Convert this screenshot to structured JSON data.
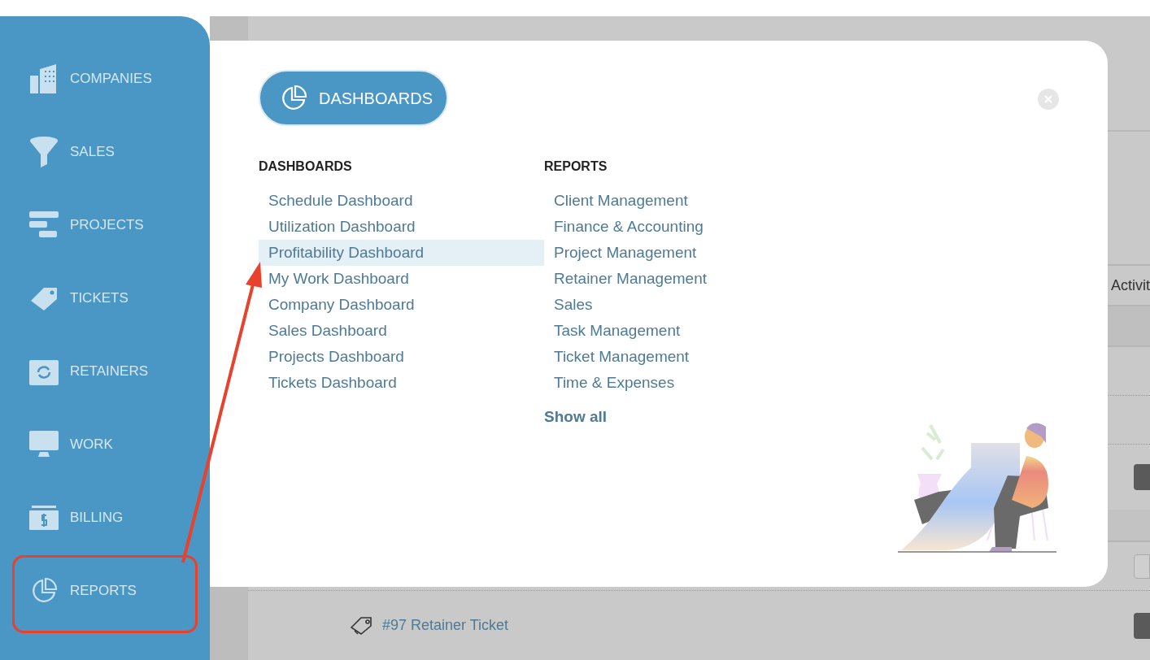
{
  "sidebar": {
    "items": [
      {
        "label": "COMPANIES"
      },
      {
        "label": "SALES"
      },
      {
        "label": "PROJECTS"
      },
      {
        "label": "TICKETS"
      },
      {
        "label": "RETAINERS"
      },
      {
        "label": "WORK"
      },
      {
        "label": "BILLING"
      },
      {
        "label": "REPORTS"
      }
    ]
  },
  "background": {
    "column_header": "Activit",
    "row_link": "#97 Retainer Ticket"
  },
  "modal": {
    "button": "DASHBOARDS",
    "columns": [
      {
        "heading": "DASHBOARDS",
        "links": [
          {
            "label": "Schedule Dashboard",
            "selected": false
          },
          {
            "label": "Utilization Dashboard",
            "selected": false
          },
          {
            "label": "Profitability Dashboard",
            "selected": true
          },
          {
            "label": "My Work Dashboard",
            "selected": false
          },
          {
            "label": "Company Dashboard",
            "selected": false
          },
          {
            "label": "Sales Dashboard",
            "selected": false
          },
          {
            "label": "Projects Dashboard",
            "selected": false
          },
          {
            "label": "Tickets Dashboard",
            "selected": false
          }
        ]
      },
      {
        "heading": "REPORTS",
        "links": [
          {
            "label": "Client Management",
            "selected": false
          },
          {
            "label": "Finance & Accounting",
            "selected": false
          },
          {
            "label": "Project Management",
            "selected": false
          },
          {
            "label": "Retainer Management",
            "selected": false
          },
          {
            "label": "Sales",
            "selected": false
          },
          {
            "label": "Task Management",
            "selected": false
          },
          {
            "label": "Ticket Management",
            "selected": false
          },
          {
            "label": "Time & Expenses",
            "selected": false
          }
        ],
        "footer_link": "Show all"
      }
    ]
  }
}
